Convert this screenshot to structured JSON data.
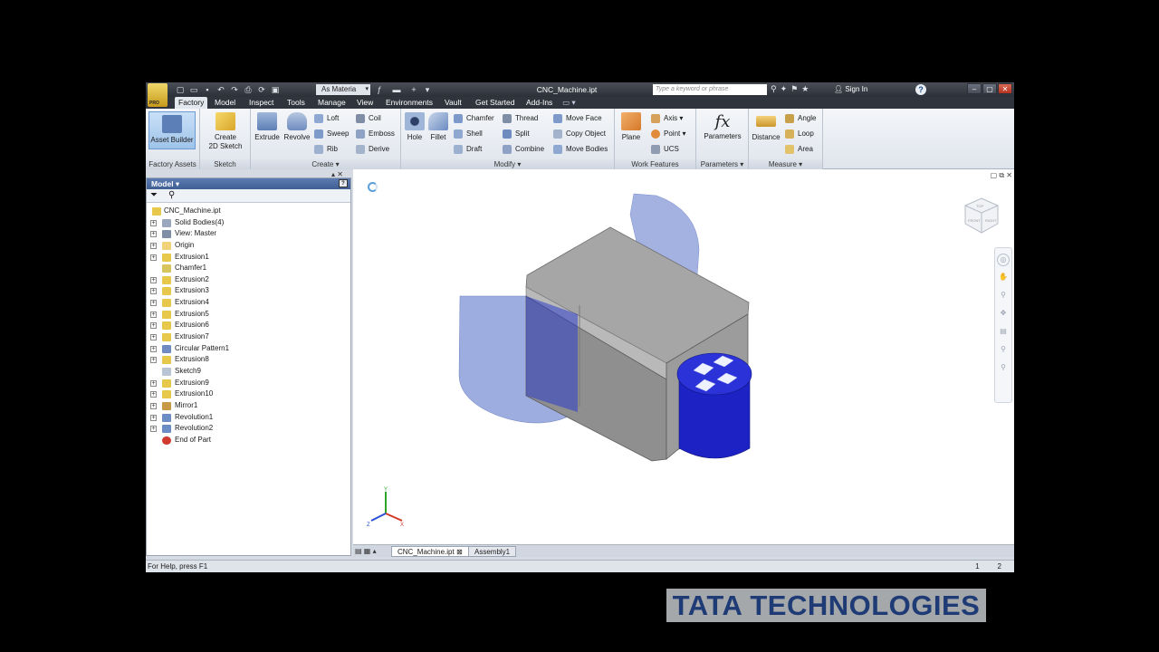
{
  "titlebar": {
    "app_badge": "PRO",
    "material": "As Materia",
    "document_title": "CNC_Machine.ipt",
    "search_placeholder": "Type a keyword or phrase",
    "sign_in": "Sign In"
  },
  "tabs": [
    "Factory",
    "Model",
    "Inspect",
    "Tools",
    "Manage",
    "View",
    "Environments",
    "Vault",
    "Get Started",
    "Add-Ins"
  ],
  "active_tab": "Factory",
  "ribbon": {
    "factory_assets": {
      "label": "Factory Assets",
      "asset_builder": "Asset Builder"
    },
    "sketch": {
      "label": "Sketch",
      "create_line1": "Create",
      "create_line2": "2D Sketch"
    },
    "create": {
      "label": "Create",
      "extrude": "Extrude",
      "revolve": "Revolve",
      "loft": "Loft",
      "sweep": "Sweep",
      "rib": "Rib",
      "coil": "Coil",
      "emboss": "Emboss",
      "derive": "Derive"
    },
    "modify": {
      "label": "Modify",
      "hole": "Hole",
      "fillet": "Fillet",
      "chamfer": "Chamfer",
      "shell": "Shell",
      "draft": "Draft",
      "thread": "Thread",
      "split": "Split",
      "combine": "Combine",
      "move_face": "Move Face",
      "copy_object": "Copy Object",
      "move_bodies": "Move Bodies"
    },
    "work_features": {
      "label": "Work Features",
      "plane": "Plane",
      "axis": "Axis",
      "point": "Point",
      "ucs": "UCS"
    },
    "parameters": {
      "label": "Parameters",
      "parameters": "Parameters",
      "fx": "fx"
    },
    "measure": {
      "label": "Measure",
      "distance": "Distance",
      "angle": "Angle",
      "loop": "Loop",
      "area": "Area"
    }
  },
  "browser": {
    "title": "Model",
    "items": [
      {
        "label": "CNC_Machine.ipt",
        "expand": false,
        "icon": "part-icon",
        "color": "#e7c84a"
      },
      {
        "label": "Solid Bodies(4)",
        "expand": true,
        "icon": "solid-bodies-icon",
        "color": "#9aa7bd"
      },
      {
        "label": "View: Master",
        "expand": true,
        "icon": "view-icon",
        "color": "#7f8da5"
      },
      {
        "label": "Origin",
        "expand": true,
        "icon": "folder-icon",
        "color": "#f0d27a"
      },
      {
        "label": "Extrusion1",
        "expand": true,
        "icon": "extrusion-icon",
        "color": "#e7c84a"
      },
      {
        "label": "Chamfer1",
        "expand": false,
        "icon": "chamfer-icon",
        "color": "#d8c45c"
      },
      {
        "label": "Extrusion2",
        "expand": true,
        "icon": "extrusion-icon",
        "color": "#e7c84a"
      },
      {
        "label": "Extrusion3",
        "expand": true,
        "icon": "extrusion-icon",
        "color": "#e7c84a"
      },
      {
        "label": "Extrusion4",
        "expand": true,
        "icon": "extrusion-icon",
        "color": "#e7c84a"
      },
      {
        "label": "Extrusion5",
        "expand": true,
        "icon": "extrusion-icon",
        "color": "#e7c84a"
      },
      {
        "label": "Extrusion6",
        "expand": true,
        "icon": "extrusion-icon",
        "color": "#e7c84a"
      },
      {
        "label": "Extrusion7",
        "expand": true,
        "icon": "extrusion-icon",
        "color": "#e7c84a"
      },
      {
        "label": "Circular Pattern1",
        "expand": true,
        "icon": "circular-pattern-icon",
        "color": "#6f8bc2"
      },
      {
        "label": "Extrusion8",
        "expand": true,
        "icon": "extrusion-icon",
        "color": "#e7c84a"
      },
      {
        "label": "Sketch9",
        "expand": false,
        "icon": "sketch-icon",
        "color": "#b9c4d4"
      },
      {
        "label": "Extrusion9",
        "expand": true,
        "icon": "extrusion-icon",
        "color": "#e7c84a"
      },
      {
        "label": "Extrusion10",
        "expand": true,
        "icon": "extrusion-icon",
        "color": "#e7c84a"
      },
      {
        "label": "Mirror1",
        "expand": true,
        "icon": "mirror-icon",
        "color": "#c79a47"
      },
      {
        "label": "Revolution1",
        "expand": true,
        "icon": "revolution-icon",
        "color": "#6b8cc4"
      },
      {
        "label": "Revolution2",
        "expand": true,
        "icon": "revolution-icon",
        "color": "#6b8cc4"
      },
      {
        "label": "End of Part",
        "expand": false,
        "icon": "end-of-part-icon",
        "color": "#d23a2f"
      }
    ]
  },
  "doc_tabs": [
    "CNC_Machine.ipt",
    "Assembly1"
  ],
  "status": {
    "help": "For Help, press F1",
    "count1": "1",
    "count2": "2"
  },
  "viewcube": {
    "front": "FRONT",
    "right": "RIGHT",
    "top": "TOP"
  },
  "watermark": "TATA TECHNOLOGIES",
  "colors": {
    "accent": "#3f5f93",
    "model_gray": "#a9a9a9",
    "model_blue": "#1a22c8",
    "ghost_blue": "#7f93d6"
  }
}
